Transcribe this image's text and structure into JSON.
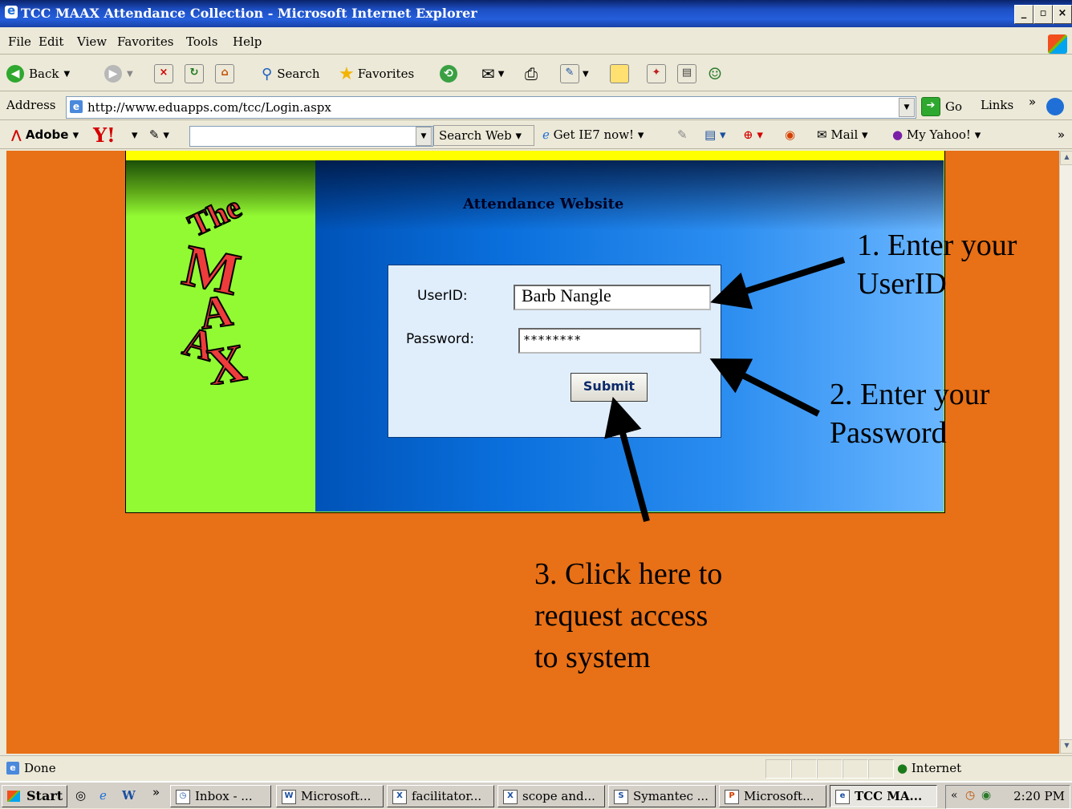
{
  "window": {
    "title": "TCC MAAX Attendance Collection - Microsoft Internet Explorer"
  },
  "menu": [
    "File",
    "Edit",
    "View",
    "Favorites",
    "Tools",
    "Help"
  ],
  "toolbar": {
    "back": "Back",
    "search": "Search",
    "favorites": "Favorites"
  },
  "address": {
    "label": "Address",
    "url": "http://www.eduapps.com/tcc/Login.aspx",
    "go": "Go",
    "links": "Links"
  },
  "yahoo": {
    "adobe": "Adobe",
    "search_web": "Search Web",
    "get_ie7": "Get IE7 now!",
    "mail": "Mail",
    "my_yahoo": "My Yahoo!"
  },
  "page": {
    "site_title": "Attendance Website",
    "login": {
      "userid_label": "UserID:",
      "userid_value": "Barb Nangle",
      "password_label": "Password:",
      "password_value": "********",
      "submit_label": "Submit"
    },
    "notes": {
      "step1_line1": "1. Enter your",
      "step1_line2": "UserID",
      "step2_line1": "2. Enter your",
      "step2_line2": "Password",
      "step3_line1": "3. Click here to",
      "step3_line2": "request access",
      "step3_line3": "to system"
    }
  },
  "status": {
    "text": "Done",
    "zone": "Internet"
  },
  "taskbar": {
    "start": "Start",
    "tasks": [
      "Inbox - ...",
      "Microsoft...",
      "facilitator...",
      "scope and...",
      "Symantec ...",
      "Microsoft...",
      "TCC MA..."
    ],
    "clock": "2:20 PM"
  },
  "colors": {
    "page_bg": "#e87016",
    "green_panel": "#92fa33",
    "accent_yellow": "#ffff00",
    "blue_panel": "#0a6fdc"
  }
}
